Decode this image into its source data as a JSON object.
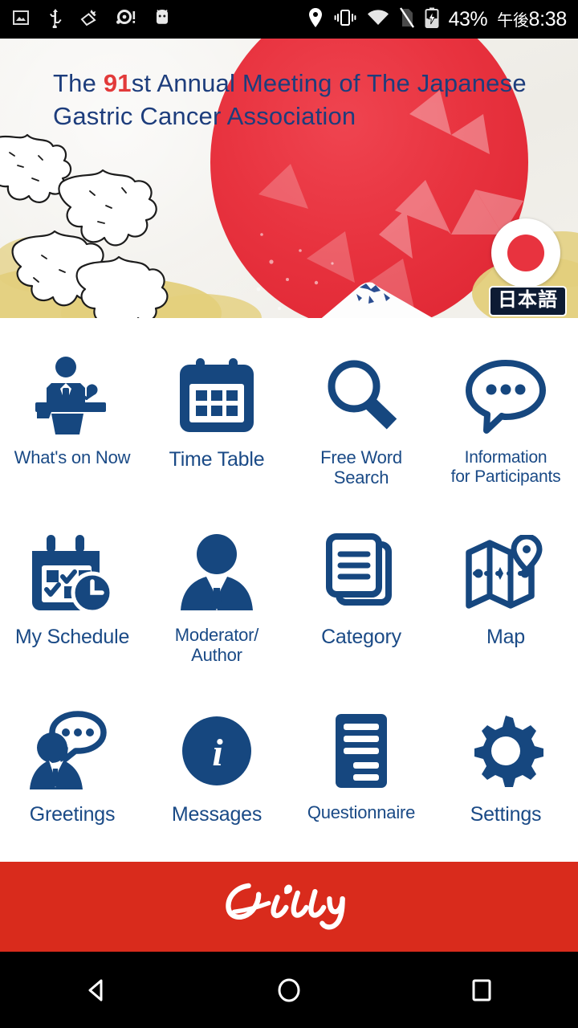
{
  "status_bar": {
    "left_icons": [
      {
        "name": "screenshot-icon",
        "label": "screenshot"
      },
      {
        "name": "usb-icon",
        "label": "usb"
      },
      {
        "name": "screen-record-icon",
        "label": "screen record"
      },
      {
        "name": "storage-alert-icon",
        "label": "storage alert"
      },
      {
        "name": "android-icon",
        "label": "android"
      }
    ],
    "right_icons": [
      {
        "name": "location-icon",
        "label": "location"
      },
      {
        "name": "vibrate-icon",
        "label": "vibrate"
      },
      {
        "name": "wifi-icon",
        "label": "wifi"
      },
      {
        "name": "no-sim-icon",
        "label": "no sim"
      },
      {
        "name": "battery-charging-icon",
        "label": "battery charging"
      }
    ],
    "battery_percent": "43%",
    "clock_ampm": "午後",
    "clock_time": "8:38"
  },
  "banner": {
    "title_line1_prefix": "The ",
    "title_number": "91",
    "title_line1_suffix": "st Annual Meeting of The Japanese",
    "title_line2": "Gastric Cancer Association",
    "language_button_label": "日本語",
    "sun_color": "#e8333f",
    "title_color": "#1d3d7c",
    "accent_red": "#e23a3a"
  },
  "menu": {
    "icon_color": "#16477f",
    "label_color": "#1a4a86",
    "items": [
      {
        "id": "whats-on-now",
        "label": "What's on Now",
        "icon": "podium-speaker-icon",
        "size": "sm"
      },
      {
        "id": "time-table",
        "label": "Time Table",
        "icon": "calendar-grid-icon",
        "size": "md"
      },
      {
        "id": "free-word-search",
        "label": "Free Word\nSearch",
        "icon": "magnifier-icon",
        "size": "sm"
      },
      {
        "id": "information-for-participants",
        "label": "Information\nfor Participants",
        "icon": "speech-bubble-dots-icon",
        "size": "xsm"
      },
      {
        "id": "my-schedule",
        "label": "My Schedule",
        "icon": "calendar-clock-icon",
        "size": "md"
      },
      {
        "id": "moderator-author",
        "label": "Moderator/\nAuthor",
        "icon": "person-suit-icon",
        "size": "sm"
      },
      {
        "id": "category",
        "label": "Category",
        "icon": "stacked-documents-icon",
        "size": "md"
      },
      {
        "id": "map",
        "label": "Map",
        "icon": "folded-map-pin-icon",
        "size": "md"
      },
      {
        "id": "greetings",
        "label": "Greetings",
        "icon": "person-speech-bubble-icon",
        "size": "md"
      },
      {
        "id": "messages",
        "label": "Messages",
        "icon": "info-circle-icon",
        "size": "md"
      },
      {
        "id": "questionnaire",
        "label": "Questionnaire",
        "icon": "form-document-icon",
        "size": "sm"
      },
      {
        "id": "settings",
        "label": "Settings",
        "icon": "gear-icon",
        "size": "md"
      }
    ]
  },
  "footer": {
    "sponsor_name": "Lilly",
    "background_color": "#d92b1c"
  },
  "nav_bar": {
    "back_label": "Back",
    "home_label": "Home",
    "recents_label": "Recents"
  }
}
